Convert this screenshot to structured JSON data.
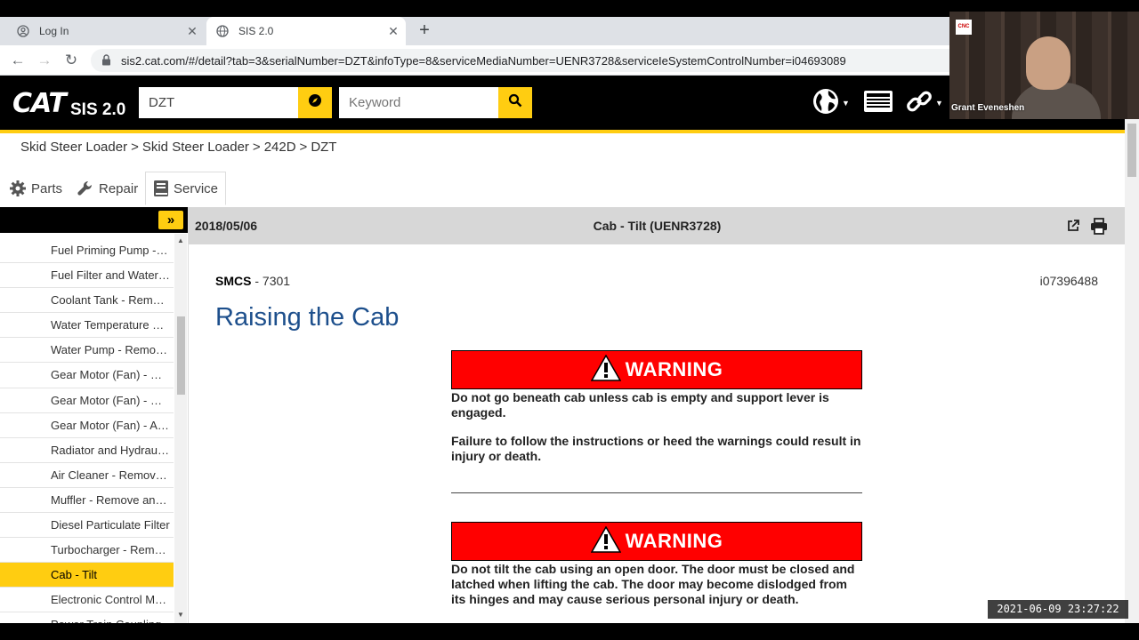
{
  "browser": {
    "tabs": [
      {
        "label": "Log In",
        "active": false,
        "icon": "google-account-icon"
      },
      {
        "label": "SIS 2.0",
        "active": true,
        "icon": "globe-icon"
      }
    ],
    "url": "sis2.cat.com/#/detail?tab=3&serialNumber=DZT&infoType=8&serviceMediaNumber=UENR3728&serviceIeSystemControlNumber=i04693089"
  },
  "header": {
    "logo": "CAT",
    "app_title": "SIS 2.0",
    "serial_value": "DZT",
    "keyword_placeholder": "Keyword",
    "accent": "#ffcd11"
  },
  "breadcrumb": [
    "Skid Steer Loader",
    "Skid Steer Loader",
    "242D",
    "DZT"
  ],
  "breadcrumb_sep": ">",
  "module_tabs": [
    {
      "label": "Parts",
      "icon": "gear-icon"
    },
    {
      "label": "Repair",
      "icon": "wrench-icon"
    },
    {
      "label": "Service",
      "icon": "book-icon",
      "active": true
    }
  ],
  "sidebar": {
    "toggle_label": "»",
    "items": [
      "Fuel Priming Pump - Remove and Install",
      "Fuel Filter and Water Separator - Remove",
      "Coolant Tank - Remove and Install",
      "Water Temperature Regulator",
      "Water Pump - Remove and Install",
      "Gear Motor (Fan) - Remove",
      "Gear Motor (Fan) - Disassemble",
      "Gear Motor (Fan) - Assemble",
      "Radiator and Hydraulic Oil Cooler",
      "Air Cleaner - Remove and Install",
      "Muffler - Remove and Install",
      "Diesel Particulate Filter",
      "Turbocharger - Remove and Install",
      "Cab - Tilt",
      "Electronic Control Module",
      "Power Train Coupling"
    ],
    "selected_index": 13
  },
  "document": {
    "date": "2018/05/06",
    "title": "Cab - Tilt (UENR3728)",
    "smcs_label": "SMCS",
    "smcs_sep": " - ",
    "smcs_code": "7301",
    "doc_id": "i07396488",
    "heading": "Raising the Cab",
    "warning_label": "WARNING",
    "warnings": [
      {
        "lines": [
          "Do not go beneath cab unless cab is empty and support lever is engaged.",
          "Failure to follow the instructions or heed the warnings could result in injury or death."
        ]
      },
      {
        "lines": [
          "Do not tilt the cab using an open door. The door must be closed and latched when lifting the cab. The door may become dislodged from its hinges and may cause serious personal injury or death."
        ]
      }
    ]
  },
  "webcam": {
    "name": "Grant Eveneshen",
    "logo": "CNC"
  },
  "timestamp": "2021-06-09 23:27:22"
}
